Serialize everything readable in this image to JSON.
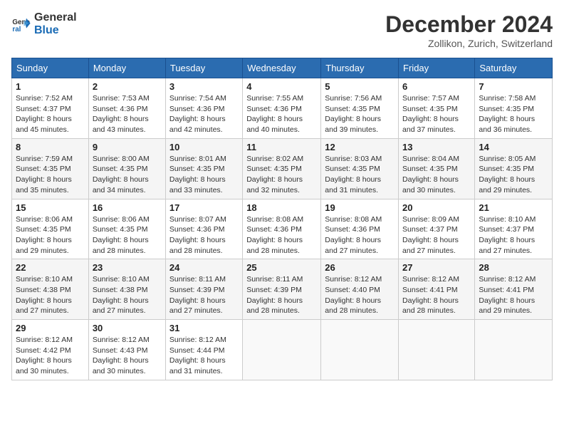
{
  "header": {
    "logo_line1": "General",
    "logo_line2": "Blue",
    "month": "December 2024",
    "location": "Zollikon, Zurich, Switzerland"
  },
  "columns": [
    "Sunday",
    "Monday",
    "Tuesday",
    "Wednesday",
    "Thursday",
    "Friday",
    "Saturday"
  ],
  "weeks": [
    [
      {
        "day": "1",
        "sunrise": "7:52 AM",
        "sunset": "4:37 PM",
        "daylight": "8 hours and 45 minutes."
      },
      {
        "day": "2",
        "sunrise": "7:53 AM",
        "sunset": "4:36 PM",
        "daylight": "8 hours and 43 minutes."
      },
      {
        "day": "3",
        "sunrise": "7:54 AM",
        "sunset": "4:36 PM",
        "daylight": "8 hours and 42 minutes."
      },
      {
        "day": "4",
        "sunrise": "7:55 AM",
        "sunset": "4:36 PM",
        "daylight": "8 hours and 40 minutes."
      },
      {
        "day": "5",
        "sunrise": "7:56 AM",
        "sunset": "4:35 PM",
        "daylight": "8 hours and 39 minutes."
      },
      {
        "day": "6",
        "sunrise": "7:57 AM",
        "sunset": "4:35 PM",
        "daylight": "8 hours and 37 minutes."
      },
      {
        "day": "7",
        "sunrise": "7:58 AM",
        "sunset": "4:35 PM",
        "daylight": "8 hours and 36 minutes."
      }
    ],
    [
      {
        "day": "8",
        "sunrise": "7:59 AM",
        "sunset": "4:35 PM",
        "daylight": "8 hours and 35 minutes."
      },
      {
        "day": "9",
        "sunrise": "8:00 AM",
        "sunset": "4:35 PM",
        "daylight": "8 hours and 34 minutes."
      },
      {
        "day": "10",
        "sunrise": "8:01 AM",
        "sunset": "4:35 PM",
        "daylight": "8 hours and 33 minutes."
      },
      {
        "day": "11",
        "sunrise": "8:02 AM",
        "sunset": "4:35 PM",
        "daylight": "8 hours and 32 minutes."
      },
      {
        "day": "12",
        "sunrise": "8:03 AM",
        "sunset": "4:35 PM",
        "daylight": "8 hours and 31 minutes."
      },
      {
        "day": "13",
        "sunrise": "8:04 AM",
        "sunset": "4:35 PM",
        "daylight": "8 hours and 30 minutes."
      },
      {
        "day": "14",
        "sunrise": "8:05 AM",
        "sunset": "4:35 PM",
        "daylight": "8 hours and 29 minutes."
      }
    ],
    [
      {
        "day": "15",
        "sunrise": "8:06 AM",
        "sunset": "4:35 PM",
        "daylight": "8 hours and 29 minutes."
      },
      {
        "day": "16",
        "sunrise": "8:06 AM",
        "sunset": "4:35 PM",
        "daylight": "8 hours and 28 minutes."
      },
      {
        "day": "17",
        "sunrise": "8:07 AM",
        "sunset": "4:36 PM",
        "daylight": "8 hours and 28 minutes."
      },
      {
        "day": "18",
        "sunrise": "8:08 AM",
        "sunset": "4:36 PM",
        "daylight": "8 hours and 28 minutes."
      },
      {
        "day": "19",
        "sunrise": "8:08 AM",
        "sunset": "4:36 PM",
        "daylight": "8 hours and 27 minutes."
      },
      {
        "day": "20",
        "sunrise": "8:09 AM",
        "sunset": "4:37 PM",
        "daylight": "8 hours and 27 minutes."
      },
      {
        "day": "21",
        "sunrise": "8:10 AM",
        "sunset": "4:37 PM",
        "daylight": "8 hours and 27 minutes."
      }
    ],
    [
      {
        "day": "22",
        "sunrise": "8:10 AM",
        "sunset": "4:38 PM",
        "daylight": "8 hours and 27 minutes."
      },
      {
        "day": "23",
        "sunrise": "8:10 AM",
        "sunset": "4:38 PM",
        "daylight": "8 hours and 27 minutes."
      },
      {
        "day": "24",
        "sunrise": "8:11 AM",
        "sunset": "4:39 PM",
        "daylight": "8 hours and 27 minutes."
      },
      {
        "day": "25",
        "sunrise": "8:11 AM",
        "sunset": "4:39 PM",
        "daylight": "8 hours and 28 minutes."
      },
      {
        "day": "26",
        "sunrise": "8:12 AM",
        "sunset": "4:40 PM",
        "daylight": "8 hours and 28 minutes."
      },
      {
        "day": "27",
        "sunrise": "8:12 AM",
        "sunset": "4:41 PM",
        "daylight": "8 hours and 28 minutes."
      },
      {
        "day": "28",
        "sunrise": "8:12 AM",
        "sunset": "4:41 PM",
        "daylight": "8 hours and 29 minutes."
      }
    ],
    [
      {
        "day": "29",
        "sunrise": "8:12 AM",
        "sunset": "4:42 PM",
        "daylight": "8 hours and 30 minutes."
      },
      {
        "day": "30",
        "sunrise": "8:12 AM",
        "sunset": "4:43 PM",
        "daylight": "8 hours and 30 minutes."
      },
      {
        "day": "31",
        "sunrise": "8:12 AM",
        "sunset": "4:44 PM",
        "daylight": "8 hours and 31 minutes."
      },
      null,
      null,
      null,
      null
    ]
  ],
  "labels": {
    "sunrise": "Sunrise:",
    "sunset": "Sunset:",
    "daylight": "Daylight:"
  }
}
